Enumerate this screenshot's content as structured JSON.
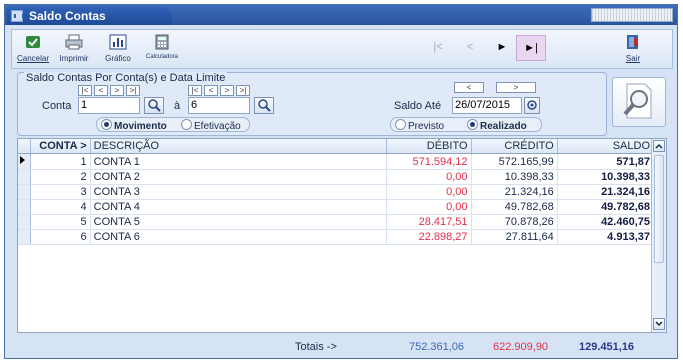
{
  "window": {
    "title": "Saldo Contas"
  },
  "toolbar": {
    "cancelar": "Cancelar",
    "imprimir": "Imprimir",
    "grafico": "Gráfico",
    "calculadora": "Calculadora",
    "sair": "Sair",
    "nav_first": "|<",
    "nav_prev": "<",
    "nav_next": "►",
    "nav_last": "►|"
  },
  "filter": {
    "legend": "Saldo Contas Por Conta(s) e Data Limite",
    "conta_label": "Conta",
    "conta_from": "1",
    "a_label": "à",
    "conta_to": "6",
    "saldo_ate_label": "Saldo Até",
    "saldo_ate_date": "26/07/2015",
    "nav_small": [
      "|<",
      "<",
      ">",
      ">|"
    ],
    "date_nav": [
      "<",
      ">"
    ],
    "tipo_options": {
      "movimento": "Movimento",
      "efetivacao": "Efetivação"
    },
    "status_options": {
      "previsto": "Previsto",
      "realizado": "Realizado"
    }
  },
  "grid": {
    "headers": {
      "conta": "CONTA >",
      "descricao": "DESCRIÇÃO",
      "debito": "DÉBITO",
      "credito": "CRÉDITO",
      "saldo": "SALDO"
    },
    "rows": [
      {
        "conta": "1",
        "descricao": "CONTA 1",
        "debito": "571.594,12",
        "credito": "572.165,99",
        "saldo": "571,87"
      },
      {
        "conta": "2",
        "descricao": "CONTA 2",
        "debito": "0,00",
        "credito": "10.398,33",
        "saldo": "10.398,33"
      },
      {
        "conta": "3",
        "descricao": "CONTA 3",
        "debito": "0,00",
        "credito": "21.324,16",
        "saldo": "21.324,16"
      },
      {
        "conta": "4",
        "descricao": "CONTA 4",
        "debito": "0,00",
        "credito": "49.782,68",
        "saldo": "49.782,68"
      },
      {
        "conta": "5",
        "descricao": "CONTA 5",
        "debito": "28.417,51",
        "credito": "70.878,26",
        "saldo": "42.460,75"
      },
      {
        "conta": "6",
        "descricao": "CONTA 6",
        "debito": "22.898,27",
        "credito": "27.811,64",
        "saldo": "4.913,37"
      }
    ]
  },
  "totals": {
    "label": "Totais ->",
    "credito": "752.361,06",
    "debito": "622.909,90",
    "saldo": "129.451,16"
  },
  "colors": {
    "title": "#2a54a0",
    "debit_red": "#e0304a",
    "credit_total": "#3a6ab0"
  }
}
